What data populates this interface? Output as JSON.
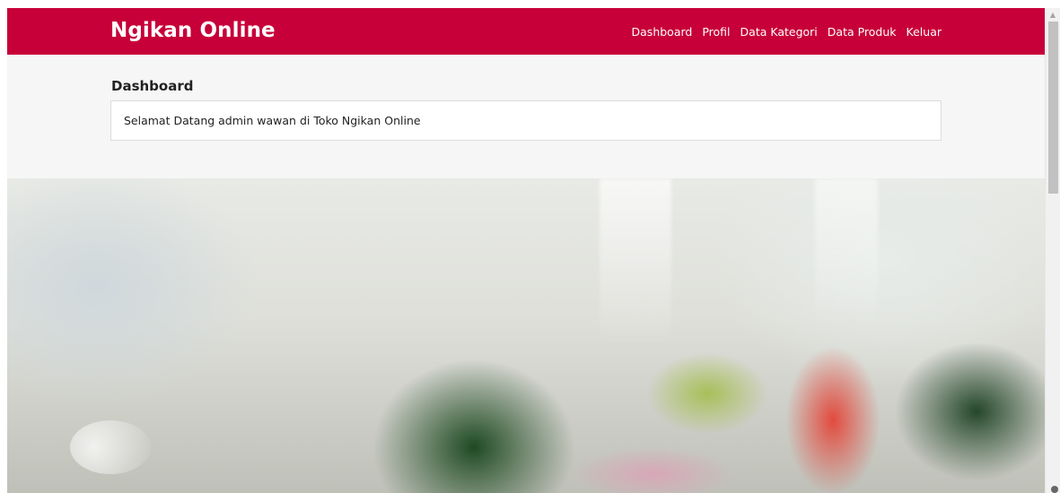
{
  "brand": {
    "name": "Ngikan Online"
  },
  "nav": {
    "items": [
      {
        "label": "Dashboard"
      },
      {
        "label": "Profil"
      },
      {
        "label": "Data Kategori"
      },
      {
        "label": "Data Produk"
      },
      {
        "label": "Keluar"
      }
    ]
  },
  "main": {
    "title": "Dashboard",
    "welcome": "Selamat Datang admin wawan di Toko Ngikan Online"
  },
  "colors": {
    "header": "#c70039",
    "page_background": "#f6f6f6",
    "welcome_box": "#ffffff"
  },
  "icons": {
    "scroll_up": "chevron-up-icon"
  }
}
